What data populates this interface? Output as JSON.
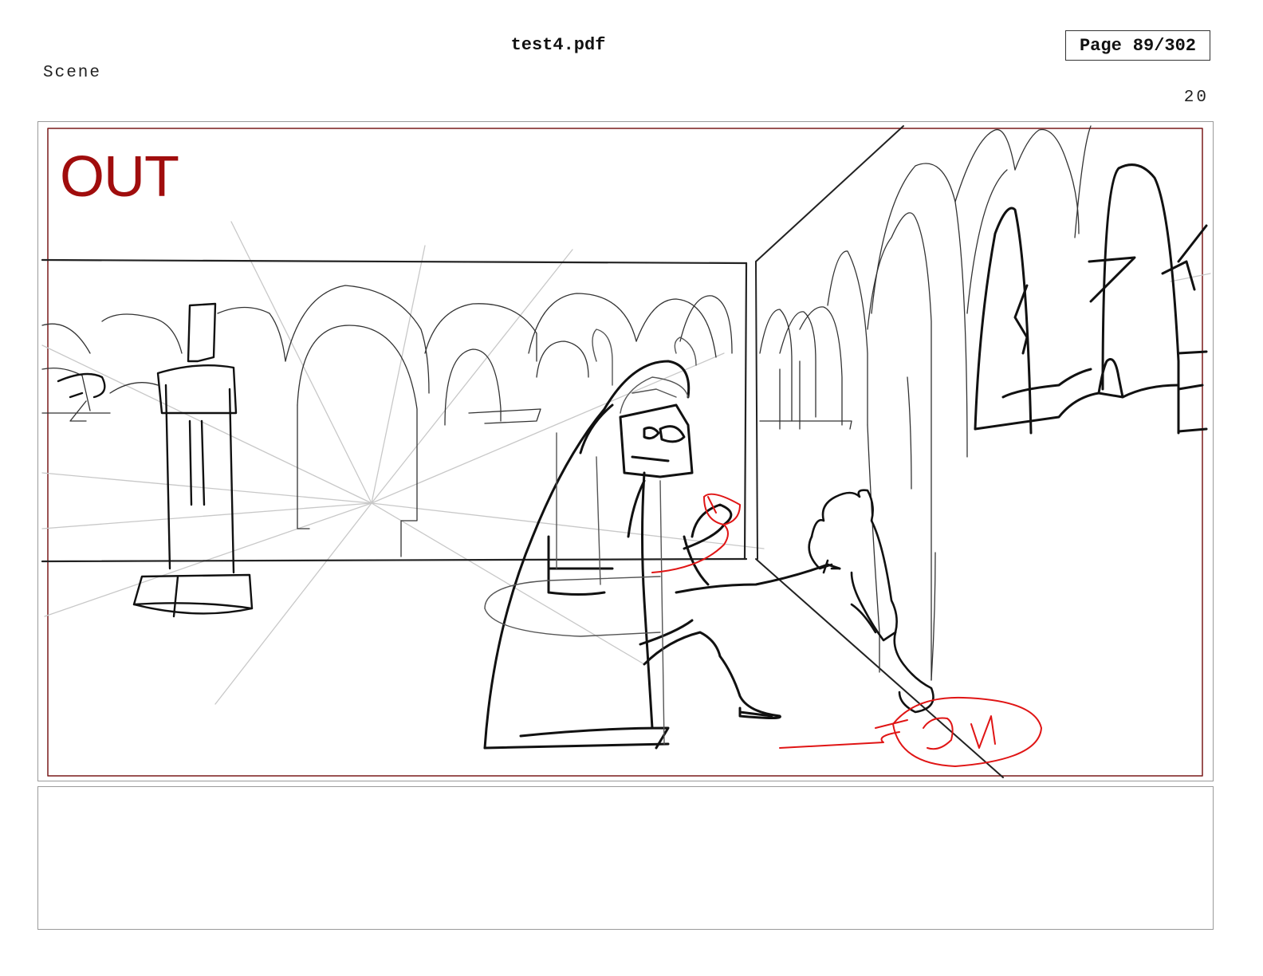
{
  "header": {
    "file_name": "test4.pdf",
    "page_label": "Page",
    "page_number": "89/302"
  },
  "scene": {
    "label": "Scene",
    "number": "20"
  },
  "panel": {
    "overlay_text": "OUT",
    "overlay_color": "#a00d0d",
    "frame_color": "#7a1a1a"
  },
  "notes": {
    "text": ""
  }
}
